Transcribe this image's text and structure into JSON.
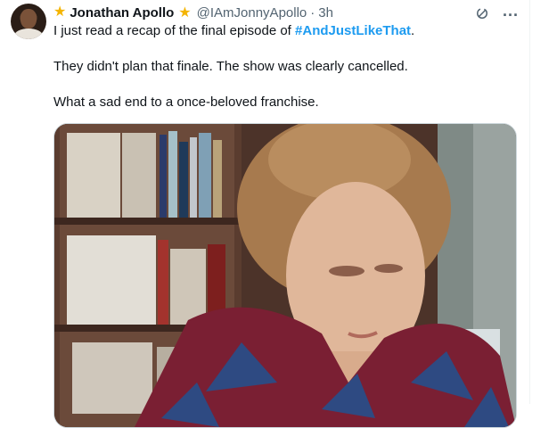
{
  "author": {
    "display_name": "Jonathan Apollo",
    "handle": "@IAmJonnyApollo",
    "separator": "·",
    "time": "3h"
  },
  "tweet": {
    "line1_prefix": "I just read a recap of the final episode of ",
    "hashtag": "#AndJustLikeThat",
    "line1_suffix": ".",
    "line2": "They didn't plan that finale. The show was clearly cancelled.",
    "line3": "What a sad end to a once-beloved franchise."
  },
  "icons": {
    "badge_left": "star-icon",
    "badge_right": "star-icon",
    "grok": "grok-icon",
    "more": "more-icon"
  },
  "colors": {
    "hashtag": "#1d9bf0",
    "star": "#f4b400",
    "secondary_text": "#536471"
  }
}
